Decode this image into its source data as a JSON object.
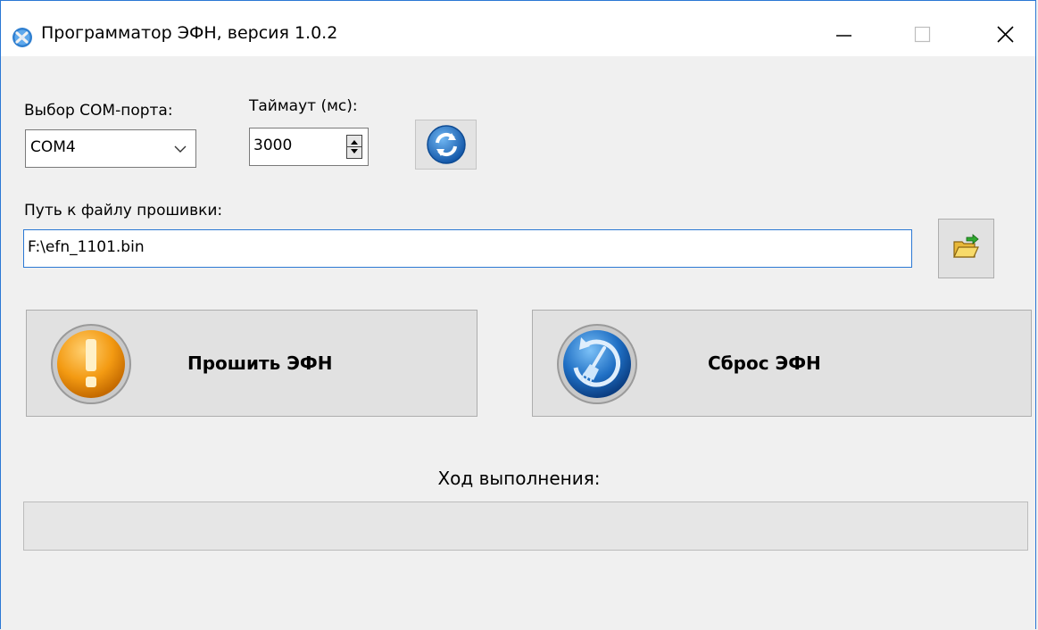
{
  "window": {
    "title": "Программатор ЭФН, версия 1.0.2",
    "app_icon": "gear-cross-icon",
    "controls": [
      "minimize-icon",
      "maximize-icon",
      "close-icon"
    ]
  },
  "port": {
    "label": "Выбор COM-порта:",
    "selected": "COM4"
  },
  "timeout": {
    "label": "Таймаут (мс):",
    "value": "3000"
  },
  "refresh": {
    "icon": "refresh-icon"
  },
  "firmware": {
    "label": "Путь к файлу прошивки:",
    "path": "F:\\efn_1101.bin",
    "browse_icon": "open-folder-icon"
  },
  "actions": {
    "flash_label": "Прошить ЭФН",
    "flash_icon": "warning-icon",
    "reset_label": "Сброс ЭФН",
    "reset_icon": "broom-reset-icon"
  },
  "progress": {
    "label": "Ход выполнения:",
    "value": 0
  },
  "colors": {
    "accent": "#2b78d4",
    "flash_icon": "#f39a12",
    "reset_icon": "#1f6fc4"
  }
}
